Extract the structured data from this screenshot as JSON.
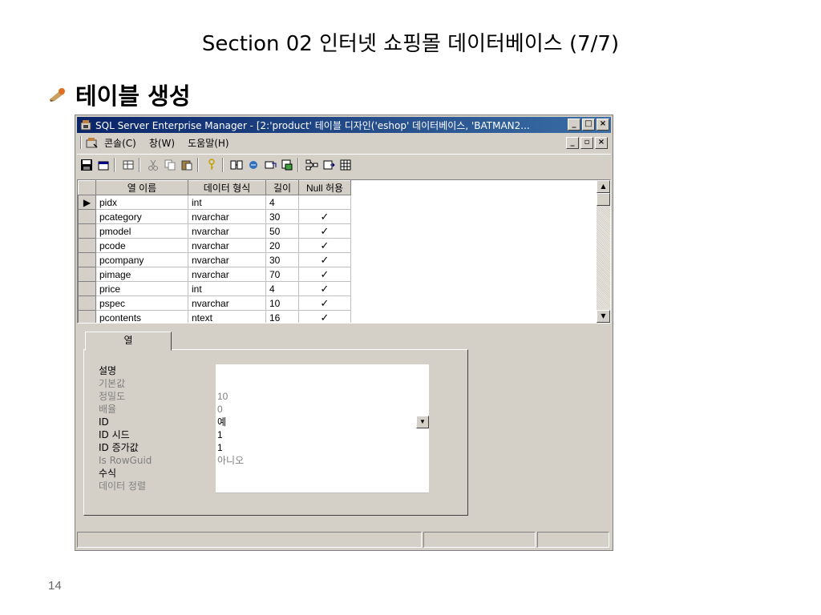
{
  "slide": {
    "title": "Section 02 인터넷 쇼핑몰 데이터베이스 (7/7)",
    "bullet": "테이블 생성",
    "page_number": "14"
  },
  "window": {
    "title": "SQL Server Enterprise Manager - [2:'product' 테이블 디자인('eshop' 데이터베이스, 'BATMAN2...",
    "caption_buttons": {
      "minimize": "_",
      "maximize": "□",
      "close": "×"
    },
    "mdi_buttons": {
      "minimize": "_",
      "restore": "▫",
      "close": "×"
    },
    "menu": [
      {
        "label": "콘솔(C)"
      },
      {
        "label": "창(W)"
      },
      {
        "label": "도움말(H)"
      }
    ],
    "toolbar_icons": [
      "save-icon",
      "properties-icon",
      "table-icon",
      "cut-icon",
      "copy-icon",
      "paste-icon",
      "key-icon",
      "relationships-icon",
      "index-icon",
      "constraints-icon",
      "triggers-icon",
      "dependencies-icon",
      "script-icon",
      "grid-icon"
    ]
  },
  "columns_grid": {
    "headers": [
      "열 이름",
      "데이터 형식",
      "길이",
      "Null 허용"
    ],
    "rows": [
      {
        "name": "pidx",
        "type": "int",
        "length": "4",
        "null": ""
      },
      {
        "name": "pcategory",
        "type": "nvarchar",
        "length": "30",
        "null": "✓"
      },
      {
        "name": "pmodel",
        "type": "nvarchar",
        "length": "50",
        "null": "✓"
      },
      {
        "name": "pcode",
        "type": "nvarchar",
        "length": "20",
        "null": "✓"
      },
      {
        "name": "pcompany",
        "type": "nvarchar",
        "length": "30",
        "null": "✓"
      },
      {
        "name": "pimage",
        "type": "nvarchar",
        "length": "70",
        "null": "✓"
      },
      {
        "name": "price",
        "type": "int",
        "length": "4",
        "null": "✓"
      },
      {
        "name": "pspec",
        "type": "nvarchar",
        "length": "10",
        "null": "✓"
      },
      {
        "name": "pcontents",
        "type": "ntext",
        "length": "16",
        "null": "✓"
      }
    ],
    "selector": "▶"
  },
  "properties": {
    "tab_label": "열",
    "items": [
      {
        "label": "설명",
        "value": "",
        "dim": false
      },
      {
        "label": "기본값",
        "value": "",
        "dim": true
      },
      {
        "label": "정밀도",
        "value": "10",
        "dim": true
      },
      {
        "label": "배율",
        "value": "0",
        "dim": true
      },
      {
        "label": "ID",
        "value": "예",
        "dim": false,
        "dropdown": true
      },
      {
        "label": "ID 시드",
        "value": "1",
        "dim": false
      },
      {
        "label": "ID 증가값",
        "value": "1",
        "dim": false
      },
      {
        "label": "Is RowGuid",
        "value": "아니오",
        "dim": true
      },
      {
        "label": "수식",
        "value": "",
        "dim": false
      },
      {
        "label": "데이터 정렬",
        "value": "",
        "dim": true
      }
    ]
  },
  "colors": {
    "titlebar_start": "#0a246a",
    "titlebar_end": "#3a6ea5",
    "chrome": "#d4d0c8",
    "dim_text": "#808080"
  }
}
